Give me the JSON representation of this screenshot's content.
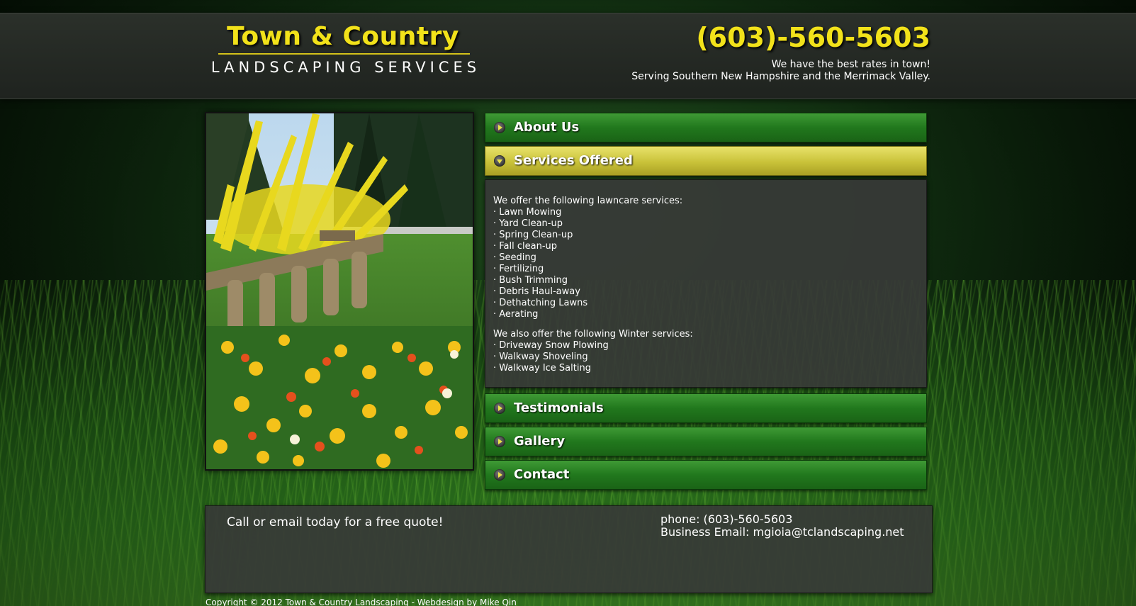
{
  "brand": {
    "title": "Town & Country",
    "subtitle": "LANDSCAPING SERVICES"
  },
  "header": {
    "phone": "(603)-560-5603",
    "tagline_1": "We have the best rates in town!",
    "tagline_2": "Serving Southern New Hampshire and the Merrimack Valley."
  },
  "accordion": {
    "items": [
      {
        "label": "About Us",
        "expanded": false
      },
      {
        "label": "Services Offered",
        "expanded": true
      },
      {
        "label": "Testimonials",
        "expanded": false
      },
      {
        "label": "Gallery",
        "expanded": false
      },
      {
        "label": "Contact",
        "expanded": false
      }
    ],
    "services": {
      "intro": "We offer the following lawncare services:",
      "lawncare": [
        "· Lawn Mowing",
        "· Yard Clean-up",
        "· Spring Clean-up",
        "· Fall clean-up",
        "· Seeding",
        "· Fertilizing",
        "· Bush Trimming",
        "· Debris Haul-away",
        "· Dethatching Lawns",
        "· Aerating"
      ],
      "winter_intro": "We also offer the following Winter services:",
      "winter": [
        "· Driveway Snow Plowing",
        "· Walkway Shoveling",
        "· Walkway Ice Salting"
      ]
    }
  },
  "footer": {
    "cta": "Call or email today for a free quote!",
    "phone": "phone: (603)-560-5603",
    "email": "Business Email: mgioia@tclandscaping.net",
    "copyright": "Copyright © 2012 Town & Country Landscaping - Webdesign by Mike Qin"
  },
  "colors": {
    "accent_yellow": "#f2e21a",
    "tab_green": "#21781d",
    "tab_active_yellow": "#c9c239",
    "panel_gray": "#373a37"
  },
  "icons": {
    "accordion_collapsed": "arrow-right-icon",
    "accordion_expanded": "arrow-down-icon"
  }
}
